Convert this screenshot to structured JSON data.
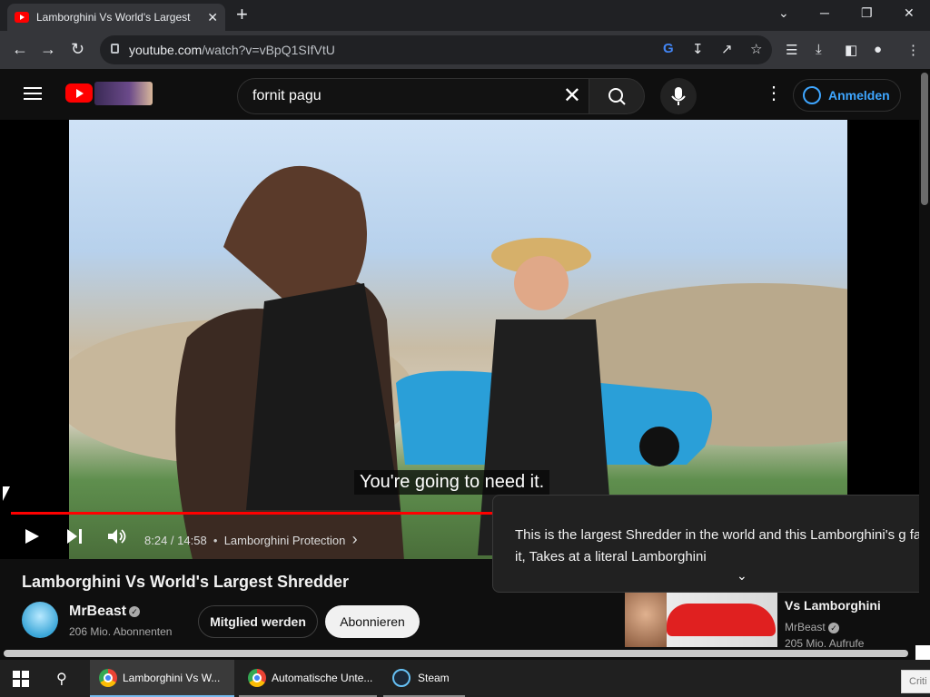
{
  "browser": {
    "tab_title": "Lamborghini Vs World's Largest",
    "tab_close": "✕",
    "new_tab": "+",
    "url_host": "youtube.com",
    "url_path": "/watch?v=vBpQ1SIfVtU",
    "window_controls": {
      "dropdown": "⌄",
      "minimize": "─",
      "restore": "❐",
      "close": "✕"
    },
    "icons": {
      "back": "arrow-left",
      "forward": "arrow-right",
      "reload": "reload",
      "lock": "lock",
      "google": "google",
      "install": "install",
      "share": "share",
      "star": "star",
      "media": "media-controls",
      "download": "download",
      "sidepanel": "side-panel",
      "profile": "profile",
      "menu": "kebab-menu"
    }
  },
  "youtube": {
    "search_query": "fornit pagu",
    "clear": "✕",
    "signin_label": "Anmelden",
    "more": "⋮"
  },
  "player": {
    "caption": "You're going to need it.",
    "time": "8:24 / 14:58",
    "separator": "•",
    "chapter": "Lamborghini Protection",
    "chapter_chevron": "›",
    "progress_fraction": 0.562
  },
  "description_popup": {
    "text": "This is the largest Shredder in the world and this Lamborghini's g fall in it, Takes at a literal Lamborghini",
    "chevron": "⌄"
  },
  "video": {
    "title": "Lamborghini Vs World's Largest Shredder",
    "channel": "MrBeast",
    "verified": "✓",
    "subscribers": "206 Mio. Abonnenten",
    "join_label": "Mitglied werden",
    "subscribe_label": "Abonnieren"
  },
  "recommended": {
    "title": "Vs Lamborghini",
    "channel": "MrBeast",
    "verified": "✓",
    "views": "205 Mio. Aufrufe"
  },
  "taskbar": {
    "items": [
      {
        "label": "Lamborghini Vs W...",
        "icon": "chrome-icon"
      },
      {
        "label": "Automatische Unte...",
        "icon": "chrome-icon"
      },
      {
        "label": "Steam",
        "icon": "steam-icon"
      }
    ],
    "search_field_text": "Criti"
  },
  "colors": {
    "accent": "#ff0000",
    "link": "#3ea6ff",
    "background": "#0f0f0f"
  }
}
